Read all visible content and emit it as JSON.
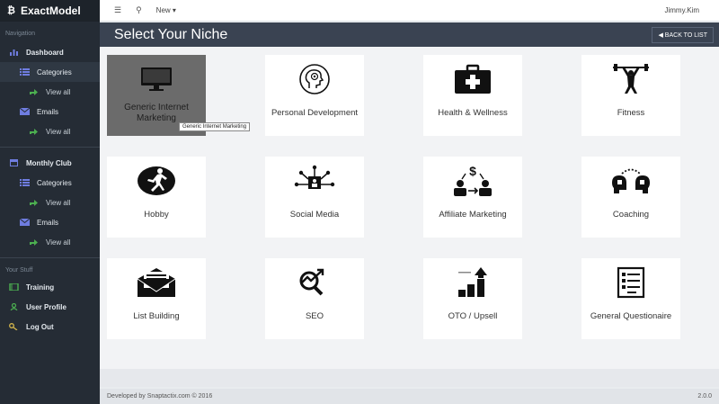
{
  "app": {
    "brand": "ExactModel",
    "brand_icon": "₿"
  },
  "sidebar": {
    "navigation_header": "Navigation",
    "your_stuff_header": "Your Stuff",
    "dashboard": "Dashboard",
    "categories_1": "Categories",
    "view_all_1": "View all",
    "emails_1": "Emails",
    "view_all_2": "View all",
    "monthly_club": "Monthly Club",
    "categories_2": "Categories",
    "view_all_3": "View all",
    "emails_2": "Emails",
    "view_all_4": "View all",
    "training": "Training",
    "user_profile": "User Profile",
    "log_out": "Log Out",
    "colors": {
      "icon_blue": "#6f7de0",
      "icon_green": "#4caf50",
      "icon_yellow": "#d4b64c"
    }
  },
  "topbar": {
    "new_label": "New ▾",
    "user": "Jimmy.Kim",
    "menu_icon": "list-icon",
    "user_icon": "user-icon"
  },
  "titlebar": {
    "title": "Select Your Niche",
    "back_label": "BACK TO LIST"
  },
  "niches": {
    "n1": "Generic Internet Marketing",
    "n2": "Personal Development",
    "n3": "Health & Wellness",
    "n4": "Fitness",
    "n5": "Hobby",
    "n6": "Social Media",
    "n7": "Affiliate Marketing",
    "n8": "Coaching",
    "n9": "List Building",
    "n10": "SEO",
    "n11": "OTO / Upsell",
    "n12": "General Questionaire"
  },
  "tooltip": "Generic Internet Marketing",
  "footer": {
    "credit": "Developed by Snaptactix.com © 2016",
    "version": "2.0.0"
  }
}
